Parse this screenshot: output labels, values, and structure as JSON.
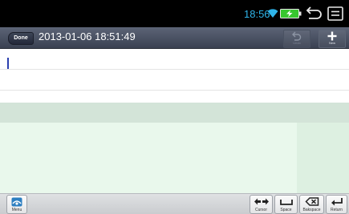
{
  "status_bar": {
    "time": "18:56",
    "time_color": "#2fb4e9",
    "icons": [
      "wifi-icon",
      "battery-charging-icon",
      "back-icon",
      "menu-icon"
    ]
  },
  "title_bar": {
    "done_label": "Done",
    "title": "2013-01-06 18:51:49",
    "undo_label": "Undo",
    "new_label": "New"
  },
  "editor": {
    "text": ""
  },
  "toolbar": {
    "menu_label": "Menu",
    "cursor_label": "Cursor",
    "space_label": "Space",
    "backspace_label": "Bakspace",
    "return_label": "Return"
  },
  "colors": {
    "title_bar": "#4a5263",
    "suggestion_bar": "#d3e4d8",
    "keyboard_area": "#e9f8ec",
    "cursor": "#2b3fae"
  }
}
